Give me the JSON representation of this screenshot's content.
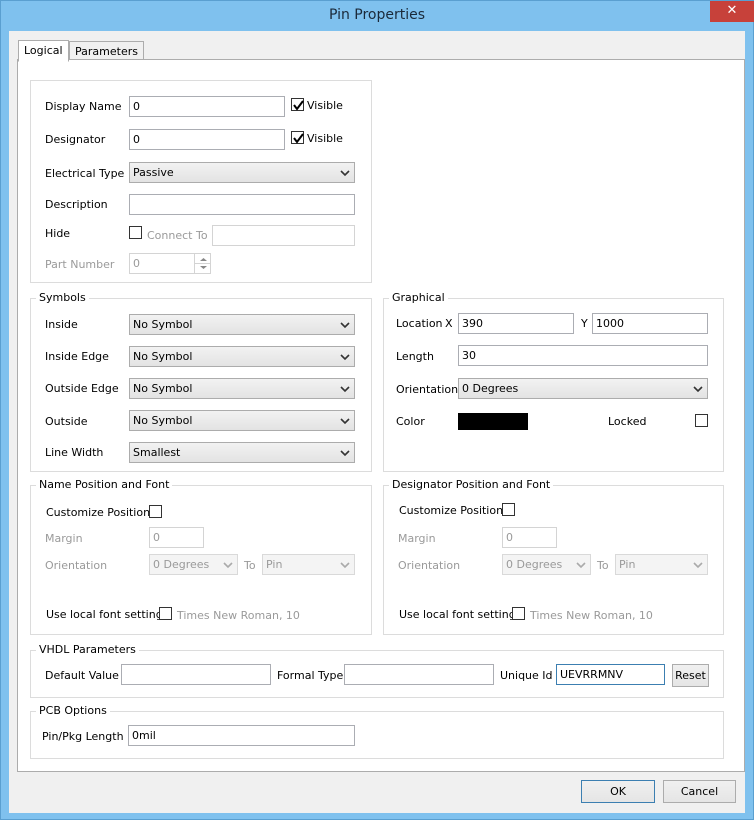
{
  "window": {
    "title": "Pin Properties",
    "close_glyph": "✕"
  },
  "tabs": [
    {
      "label": "Logical"
    },
    {
      "label": "Parameters"
    }
  ],
  "logical": {
    "display_name_label": "Display Name",
    "display_name_value": "0",
    "display_name_visible": "Visible",
    "designator_label": "Designator",
    "designator_value": "0",
    "designator_visible": "Visible",
    "electrical_type_label": "Electrical Type",
    "electrical_type_value": "Passive",
    "description_label": "Description",
    "description_value": "",
    "hide_label": "Hide",
    "connect_to_label": "Connect To",
    "connect_to_value": "",
    "part_number_label": "Part Number",
    "part_number_value": "0"
  },
  "symbols": {
    "title": "Symbols",
    "inside_label": "Inside",
    "inside_value": "No Symbol",
    "inside_edge_label": "Inside Edge",
    "inside_edge_value": "No Symbol",
    "outside_edge_label": "Outside Edge",
    "outside_edge_value": "No Symbol",
    "outside_label": "Outside",
    "outside_value": "No Symbol",
    "line_width_label": "Line Width",
    "line_width_value": "Smallest"
  },
  "graphical": {
    "title": "Graphical",
    "location_label": "Location",
    "x_label": "X",
    "x_value": "390",
    "y_label": "Y",
    "y_value": "1000",
    "length_label": "Length",
    "length_value": "30",
    "orientation_label": "Orientation",
    "orientation_value": "0 Degrees",
    "color_label": "Color",
    "color_hex": "#000000",
    "locked_label": "Locked"
  },
  "name_position": {
    "title": "Name Position and Font",
    "customize_label": "Customize Position",
    "margin_label": "Margin",
    "margin_value": "0",
    "orientation_label": "Orientation",
    "orientation_value": "0 Degrees",
    "to_label": "To",
    "to_value": "Pin",
    "font_label": "Use local font setting",
    "font_value": "Times New Roman, 10"
  },
  "designator_position": {
    "title": "Designator Position and Font",
    "customize_label": "Customize Position",
    "margin_label": "Margin",
    "margin_value": "0",
    "orientation_label": "Orientation",
    "orientation_value": "0 Degrees",
    "to_label": "To",
    "to_value": "Pin",
    "font_label": "Use local font setting",
    "font_value": "Times New Roman, 10"
  },
  "vhdl": {
    "title": "VHDL Parameters",
    "default_value_label": "Default Value",
    "default_value": "",
    "formal_type_label": "Formal Type",
    "formal_type_value": "",
    "unique_id_label": "Unique Id",
    "unique_id_value": "UEVRRMNV",
    "reset_label": "Reset"
  },
  "pcb": {
    "title": "PCB Options",
    "pin_pkg_label": "Pin/Pkg Length",
    "pin_pkg_value": "0mil"
  },
  "footer": {
    "ok_label": "OK",
    "cancel_label": "Cancel"
  }
}
